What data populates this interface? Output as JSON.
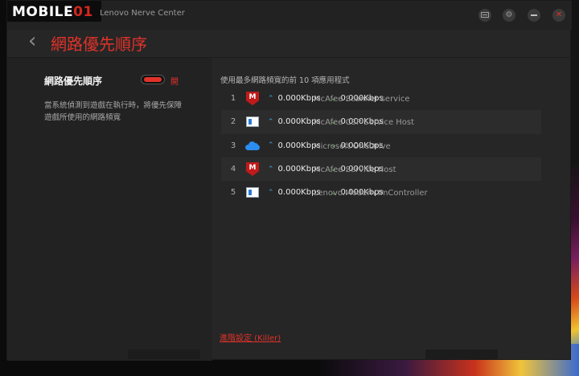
{
  "watermark": {
    "brand_left": "MOBILE",
    "brand_right": "01",
    "app_name": "Lenovo Nerve Center"
  },
  "titlebar": {
    "icons": [
      "chat-icon",
      "gear-icon",
      "minimize-icon",
      "close-icon"
    ]
  },
  "header": {
    "back_icon": "chevron-left-icon",
    "title": "網路優先順序"
  },
  "setting": {
    "label": "網路優先順序",
    "toggle_state": "開",
    "toggle_on": true,
    "description": "當系統偵測到遊戲在執行時，將優先保障遊戲所使用的網路頻寬"
  },
  "list": {
    "title": "使用最多網路頻寬的前 10 項應用程式",
    "rows": [
      {
        "num": "1",
        "icon": "mcafee-icon",
        "name": "McAfee Scanner service",
        "up": "0.000Kbps",
        "down": "0.000Kbps"
      },
      {
        "num": "2",
        "icon": "window-app-icon",
        "name": "McAfee CSP Service Host",
        "up": "0.000Kbps",
        "down": "0.000Kbps"
      },
      {
        "num": "3",
        "icon": "onedrive-cloud-icon",
        "name": "Microsoft OneDrive",
        "up": "0.000Kbps",
        "down": "0.000Kbps"
      },
      {
        "num": "4",
        "icon": "mcafee-icon",
        "name": "McAfee Service Host",
        "up": "0.000Kbps",
        "down": "0.000Kbps"
      },
      {
        "num": "5",
        "icon": "window-app-icon",
        "name": "Lenovo.Modern.ImController",
        "up": "0.000Kbps",
        "down": "0.000Kbps"
      }
    ]
  },
  "footer": {
    "advanced_link": "進階設定 (Killer)"
  },
  "colors": {
    "accent": "#e0322a",
    "upload_arrow": "#35a6e8",
    "download_arrow": "#5ccc3c",
    "background": "#262626"
  }
}
